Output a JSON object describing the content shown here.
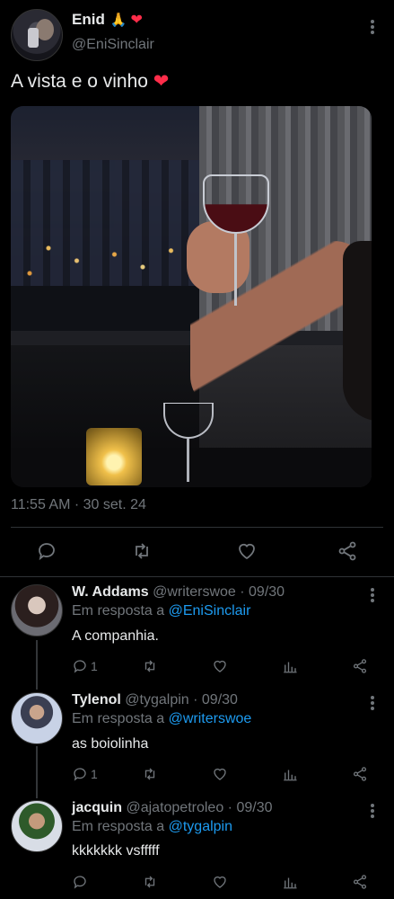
{
  "tweet": {
    "name": "Enid",
    "name_emoji_pray": "🙏",
    "name_emoji_heart": "❤",
    "handle": "@EniSinclair",
    "text": "A vista e o vinho",
    "text_emoji": "❤",
    "timestamp": "11:55 AM · 30 set. 24"
  },
  "replies": [
    {
      "name": "W. Addams",
      "handle_date": "@writerswoe · 09/30",
      "reply_prefix": "Em resposta a",
      "reply_to": "@EniSinclair",
      "text": "A companhia.",
      "reply_count": "1"
    },
    {
      "name": "Tylenol",
      "handle_date": "@tygalpin · 09/30",
      "reply_prefix": "Em resposta a",
      "reply_to": "@writerswoe",
      "text": "as boiolinha",
      "reply_count": "1"
    },
    {
      "name": "jacquin",
      "handle_date": "@ajatopetroleo · 09/30",
      "reply_prefix": "Em resposta a",
      "reply_to": "@tygalpin",
      "text": "kkkkkkk vsfffff",
      "reply_count": ""
    }
  ],
  "icons": {
    "reply": "reply-icon",
    "retweet": "retweet-icon",
    "like": "heart-icon",
    "views": "views-icon",
    "share": "share-icon",
    "more": "more-icon"
  },
  "colors": {
    "background": "#000000",
    "text": "#e7e9ea",
    "muted": "#71767b",
    "link": "#1d9bf0",
    "heart": "#ff2d4a"
  }
}
